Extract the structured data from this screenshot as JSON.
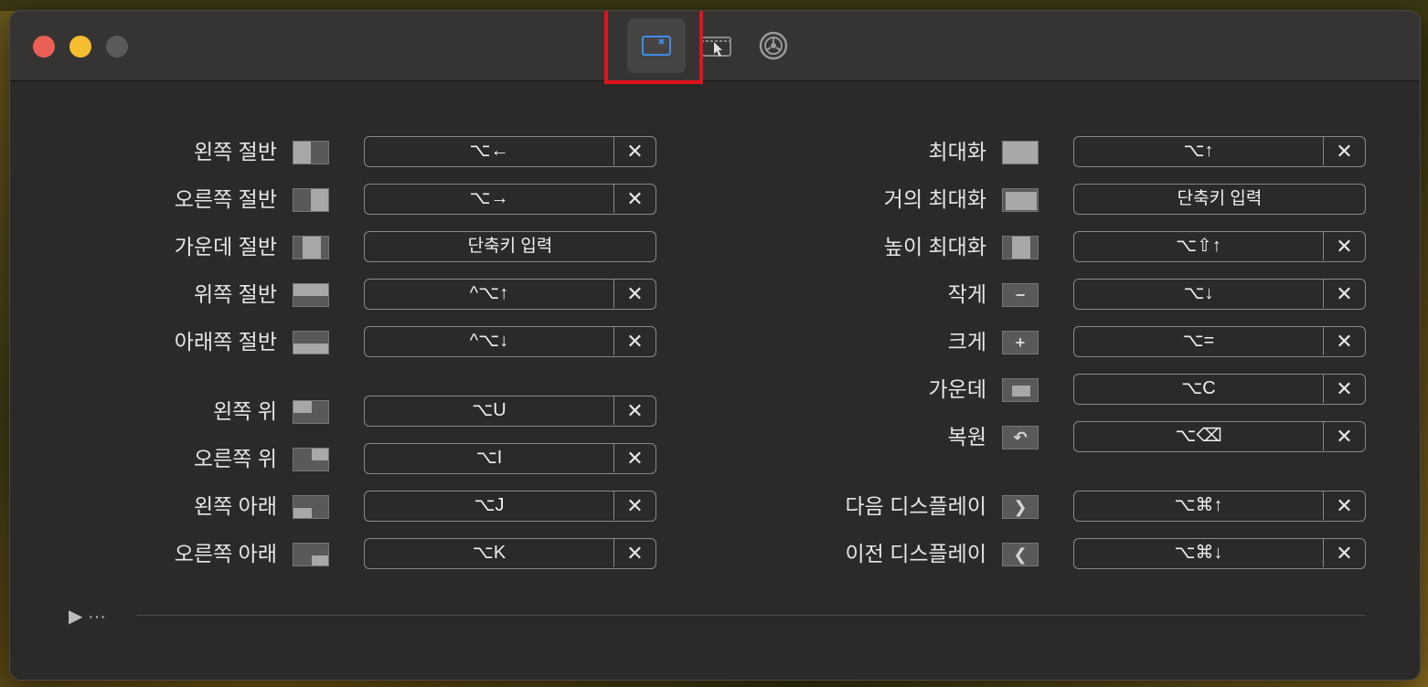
{
  "toolbar": {
    "tabs": [
      {
        "icon": "keyboard-shortcuts-icon",
        "active": true
      },
      {
        "icon": "snap-areas-icon",
        "active": false
      },
      {
        "icon": "gear-icon",
        "active": false
      }
    ]
  },
  "shortcuts": {
    "left": [
      {
        "label": "왼쪽 절반",
        "key": "⌥←",
        "clearable": true
      },
      {
        "label": "오른쪽 절반",
        "key": "⌥→",
        "clearable": true
      },
      {
        "label": "가운데 절반",
        "placeholder": "단축키 입력",
        "clearable": false
      },
      {
        "label": "위쪽 절반",
        "key": "^⌥↑",
        "clearable": true
      },
      {
        "label": "아래쪽 절반",
        "key": "^⌥↓",
        "clearable": true
      },
      {
        "label": "왼쪽 위",
        "key": "⌥U",
        "clearable": true
      },
      {
        "label": "오른쪽 위",
        "key": "⌥I",
        "clearable": true
      },
      {
        "label": "왼쪽 아래",
        "key": "⌥J",
        "clearable": true
      },
      {
        "label": "오른쪽 아래",
        "key": "⌥K",
        "clearable": true
      }
    ],
    "right": [
      {
        "label": "최대화",
        "key": "⌥↑",
        "clearable": true
      },
      {
        "label": "거의 최대화",
        "placeholder": "단축키 입력",
        "clearable": false
      },
      {
        "label": "높이 최대화",
        "key": "⌥⇧↑",
        "clearable": true
      },
      {
        "label": "작게",
        "key": "⌥↓",
        "clearable": true
      },
      {
        "label": "크게",
        "key": "⌥=",
        "clearable": true
      },
      {
        "label": "가운데",
        "key": "⌥C",
        "clearable": true
      },
      {
        "label": "복원",
        "key": "⌥⌫",
        "clearable": true
      },
      {
        "label": "다음 디스플레이",
        "key": "⌥⌘↑",
        "clearable": true
      },
      {
        "label": "이전 디스플레이",
        "key": "⌥⌘↓",
        "clearable": true
      }
    ]
  },
  "clear_glyph": "✕",
  "footer": {
    "toggle": "▶ ···"
  }
}
